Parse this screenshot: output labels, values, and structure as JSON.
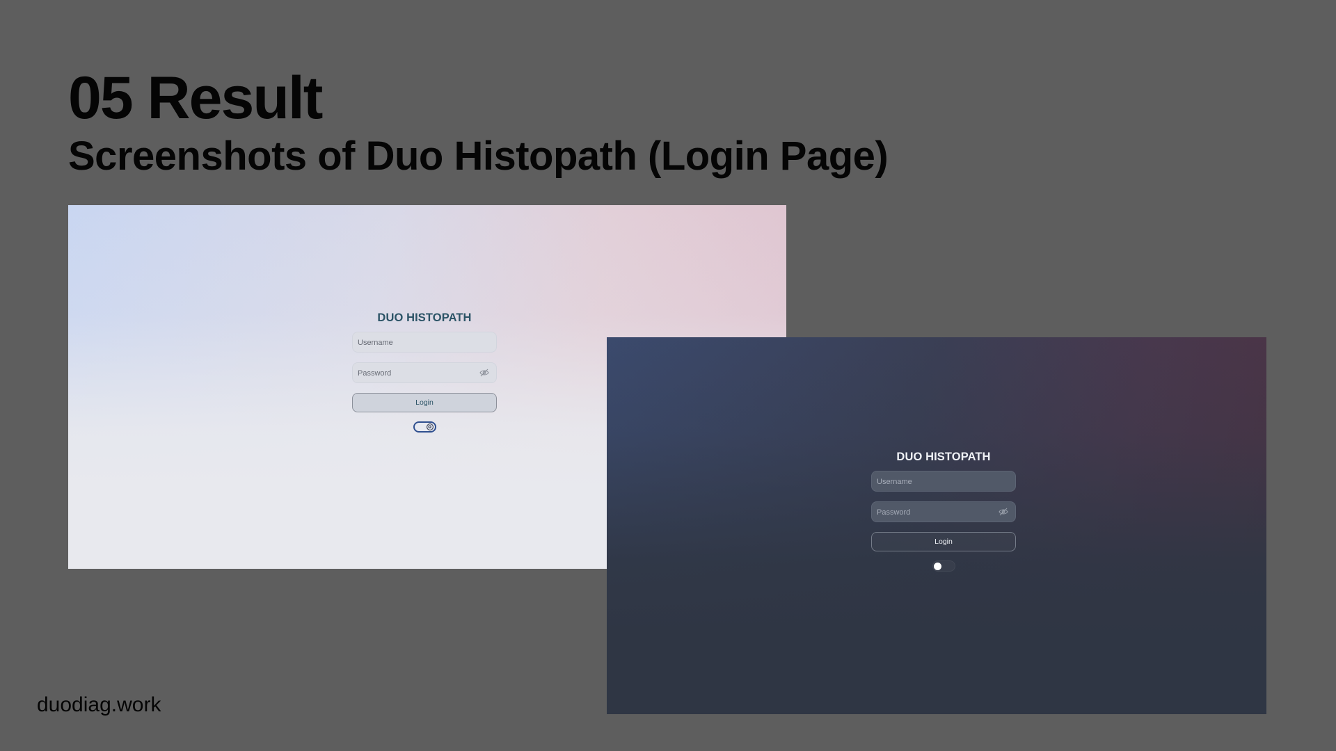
{
  "slide": {
    "title": "05 Result",
    "subtitle": "Screenshots of Duo Histopath (Login Page)",
    "footer": "duodiag.work"
  },
  "screenshots": [
    {
      "theme": "light",
      "brand": "DUO HISTOPATH",
      "username_placeholder": "Username",
      "password_placeholder": "Password",
      "password_toggle_icon": "eye-slash-icon",
      "login_label": "Login",
      "theme_toggle_icon": "sun-icon",
      "theme_toggle_on": true,
      "colors": {
        "brand": "#2b5366",
        "toggle_border": "#2f4f8f"
      }
    },
    {
      "theme": "dark",
      "brand": "DUO HISTOPATH",
      "username_placeholder": "Username",
      "password_placeholder": "Password",
      "password_toggle_icon": "eye-slash-icon",
      "login_label": "Login",
      "theme_toggle_icon": "moon-icon",
      "theme_toggle_on": false,
      "colors": {
        "brand": "#f0f2f6",
        "background_top": "#3b4a6d",
        "background_bottom": "#2f3644"
      }
    }
  ],
  "colors": {
    "slide_background": "#5e5e5e",
    "text": "#050505"
  }
}
